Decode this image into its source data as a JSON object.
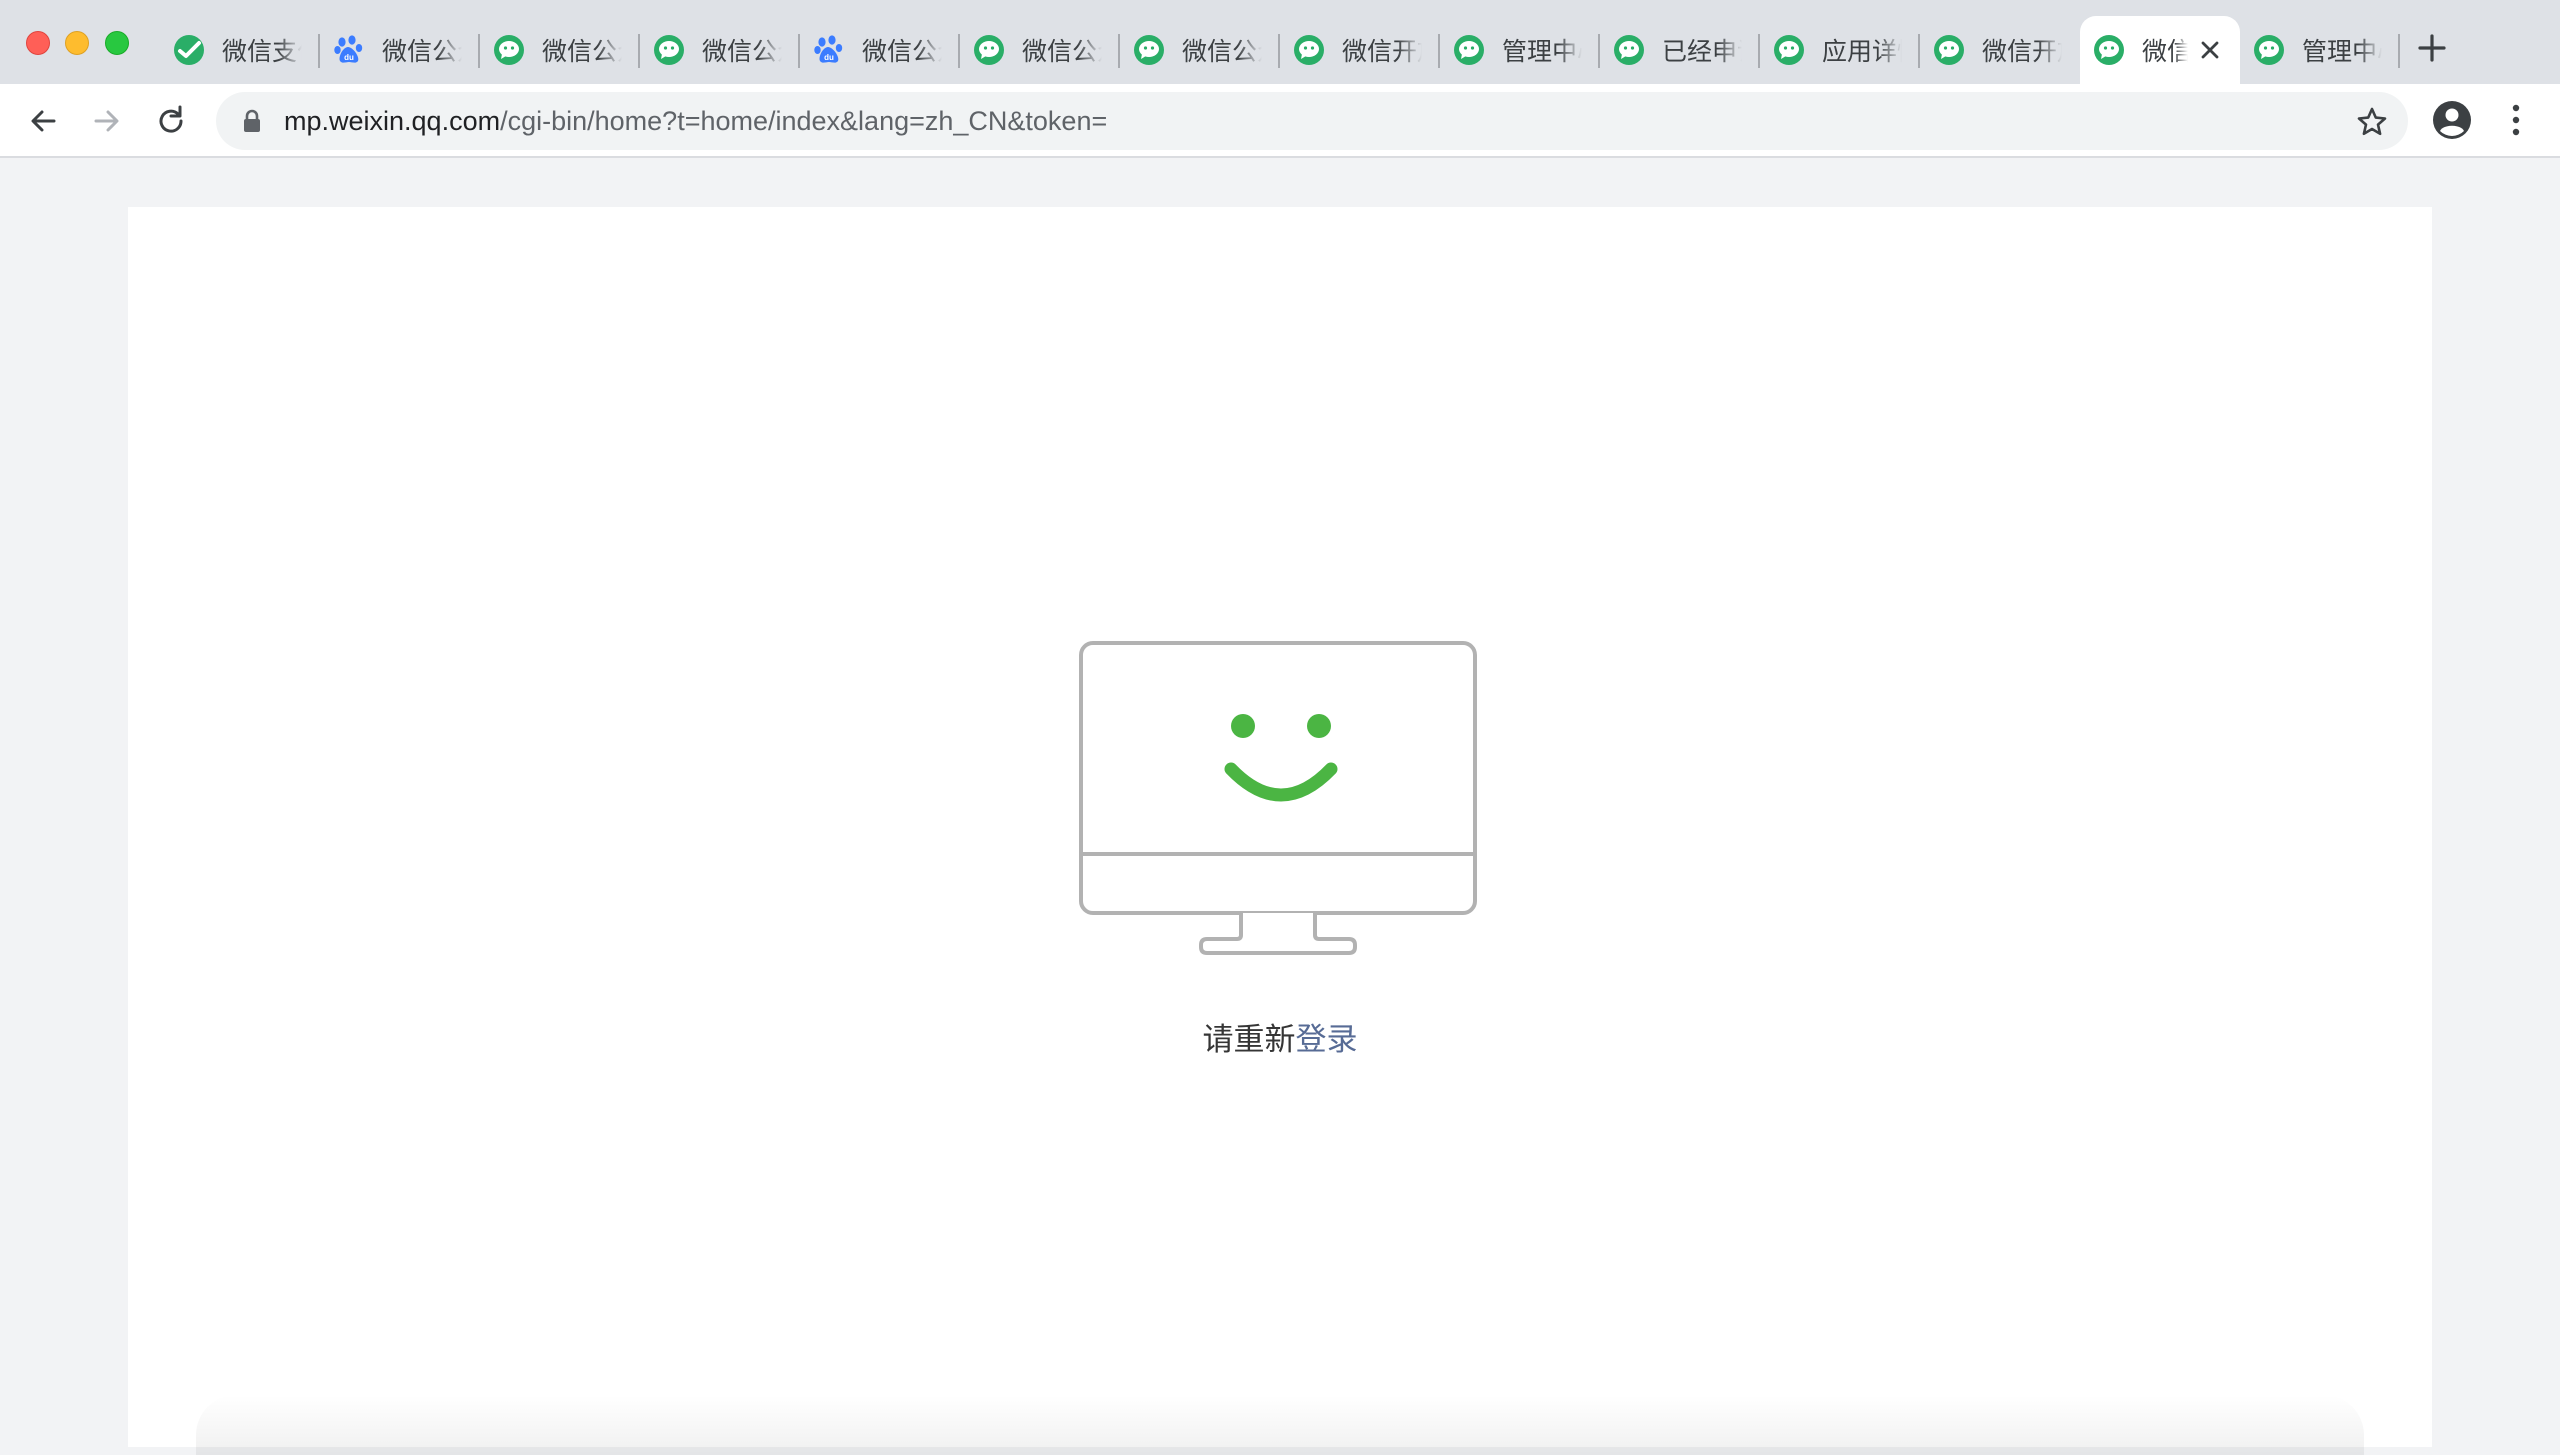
{
  "browser": {
    "tabs": [
      {
        "title": "微信支付",
        "icon": "wechat-pay-icon",
        "active": false
      },
      {
        "title": "微信公众平台",
        "icon": "baidu-paw-icon",
        "active": false
      },
      {
        "title": "微信公众平台",
        "icon": "wechat-icon",
        "active": false
      },
      {
        "title": "微信公众平台",
        "icon": "wechat-icon",
        "active": false
      },
      {
        "title": "微信公众平台",
        "icon": "baidu-paw-icon",
        "active": false
      },
      {
        "title": "微信公众平台",
        "icon": "wechat-icon",
        "active": false
      },
      {
        "title": "微信公众平台",
        "icon": "wechat-icon",
        "active": false
      },
      {
        "title": "微信开放平台",
        "icon": "wechat-icon",
        "active": false
      },
      {
        "title": "管理中心",
        "icon": "wechat-icon",
        "active": false
      },
      {
        "title": "已经申请",
        "icon": "wechat-icon",
        "active": false
      },
      {
        "title": "应用详情",
        "icon": "wechat-icon",
        "active": false
      },
      {
        "title": "微信开放平台",
        "icon": "wechat-icon",
        "active": false
      },
      {
        "title": "微信",
        "icon": "wechat-icon",
        "active": true
      },
      {
        "title": "管理中心",
        "icon": "wechat-icon",
        "active": false
      }
    ],
    "address": {
      "host": "mp.weixin.qq.com",
      "path": "/cgi-bin/home?t=home/index&lang=zh_CN&token="
    }
  },
  "page": {
    "prompt_text": "请重新",
    "login_link": "登录"
  },
  "colors": {
    "wechat_green": "#2aae67",
    "smile_green": "#4bb543",
    "monitor_gray": "#b2b2b2",
    "link_blue": "#576b95",
    "baidu_blue": "#3b7cff"
  }
}
